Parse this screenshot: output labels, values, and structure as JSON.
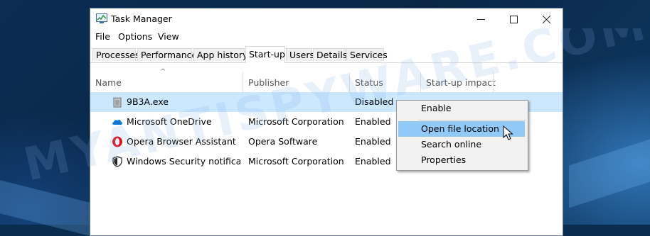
{
  "window": {
    "title": "Task Manager"
  },
  "window_controls": {
    "minimize": "—",
    "maximize": "☐",
    "close": "✕"
  },
  "menu": [
    "File",
    "Options",
    "View"
  ],
  "tabs": [
    "Processes",
    "Performance",
    "App history",
    "Start-up",
    "Users",
    "Details",
    "Services"
  ],
  "active_tab": "Start-up",
  "columns": [
    "Name",
    "Publisher",
    "Status",
    "Start-up impact"
  ],
  "rows": [
    {
      "name": "9B3A.exe",
      "publisher": "",
      "status": "Disabled",
      "icon": "recycle-bin-icon",
      "selected": true
    },
    {
      "name": "Microsoft OneDrive",
      "publisher": "Microsoft Corporation",
      "status": "Enabled",
      "icon": "onedrive-cloud-icon"
    },
    {
      "name": "Opera Browser Assistant",
      "publisher": "Opera Software",
      "status": "Enabled",
      "icon": "opera-icon"
    },
    {
      "name": "Windows Security notificati...",
      "publisher": "Microsoft Corporation",
      "status": "Enabled",
      "icon": "shield-icon"
    }
  ],
  "context_menu": [
    "Enable",
    "Open file location",
    "Search online",
    "Properties"
  ],
  "context_menu_hover": "Open file location",
  "watermark": "MYANTISPYWARE.COM",
  "colors": {
    "selection": "#cce8ff",
    "menu_hover": "#91c9f7",
    "onedrive_blue": "#0a78d4",
    "opera_red": "#e0101f"
  }
}
